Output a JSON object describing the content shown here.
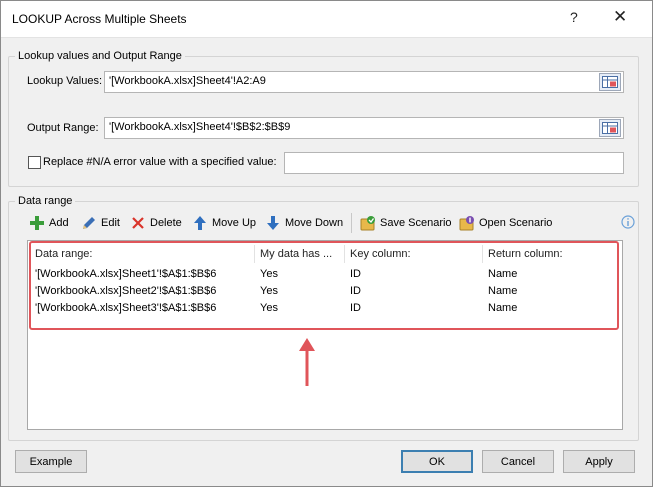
{
  "window": {
    "title": "LOOKUP Across Multiple Sheets",
    "help": "?",
    "close": "✕"
  },
  "lookup_group": {
    "legend": "Lookup values and Output Range",
    "lookup_values_label": "Lookup Values:",
    "lookup_values": "'[WorkbookA.xlsx]Sheet4'!A2:A9",
    "output_range_label": "Output Range:",
    "output_range": "'[WorkbookA.xlsx]Sheet4'!$B$2:$B$9",
    "replace_label": "Replace #N/A error value with a specified value:",
    "replace_checked": false,
    "replace_value": ""
  },
  "data_group": {
    "legend": "Data range",
    "toolbar": {
      "add": "Add",
      "edit": "Edit",
      "delete": "Delete",
      "move_up": "Move Up",
      "move_down": "Move Down",
      "save_scenario": "Save Scenario",
      "open_scenario": "Open Scenario"
    },
    "columns": [
      "Data range:",
      "My data has ...",
      "Key column:",
      "Return column:"
    ],
    "rows": [
      [
        "'[WorkbookA.xlsx]Sheet1'!$A$1:$B$6",
        "Yes",
        "ID",
        "Name"
      ],
      [
        "'[WorkbookA.xlsx]Sheet2'!$A$1:$B$6",
        "Yes",
        "ID",
        "Name"
      ],
      [
        "'[WorkbookA.xlsx]Sheet3'!$A$1:$B$6",
        "Yes",
        "ID",
        "Name"
      ]
    ]
  },
  "footer": {
    "example": "Example",
    "ok": "OK",
    "cancel": "Cancel",
    "apply": "Apply"
  },
  "colors": {
    "highlight": "#e0555a",
    "accent": "#3c7fb1"
  }
}
